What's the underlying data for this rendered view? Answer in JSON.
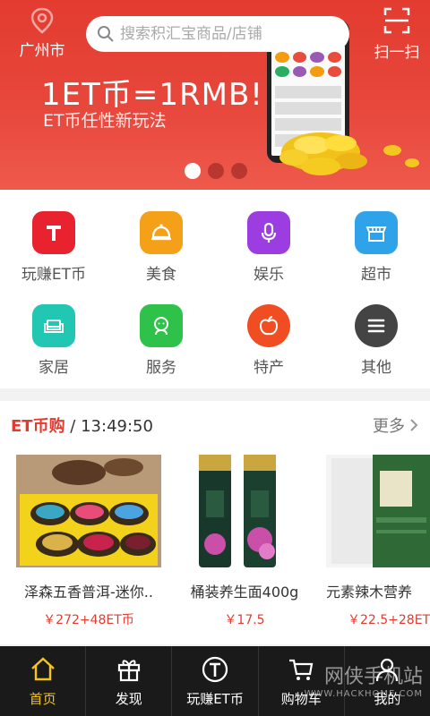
{
  "header": {
    "city": "广州市",
    "search_placeholder": "搜索积汇宝商品/店铺",
    "scan_label": "扫一扫"
  },
  "banner": {
    "headline": "1ET币=1RMB!",
    "subline": "ET币任性新玩法",
    "slide_count": 3,
    "active_slide": 1
  },
  "categories": [
    {
      "label": "玩赚ET币",
      "icon": "t-letter-icon",
      "color": "#e8232f"
    },
    {
      "label": "美食",
      "icon": "food-cloche-icon",
      "color": "#f5a019"
    },
    {
      "label": "娱乐",
      "icon": "microphone-icon",
      "color": "#9b3de0"
    },
    {
      "label": "超市",
      "icon": "store-icon",
      "color": "#2fa3ea"
    },
    {
      "label": "家居",
      "icon": "sofa-icon",
      "color": "#22c7b4"
    },
    {
      "label": "服务",
      "icon": "person-icon",
      "color": "#2ec24a"
    },
    {
      "label": "特产",
      "icon": "apple-icon",
      "color": "#f04e22"
    },
    {
      "label": "其他",
      "icon": "menu-icon",
      "color": "#444444"
    }
  ],
  "et_section": {
    "title": "ET币购",
    "separator": " / ",
    "time": "13:49:50",
    "more_label": "更多"
  },
  "products": [
    {
      "name": "泽森五香普洱-迷你..",
      "price": "￥272+48ET币"
    },
    {
      "name": "桶装养生面400g",
      "price": "￥17.5"
    },
    {
      "name": "元素辣木营养",
      "price": "￥22.5+28ET"
    }
  ],
  "tabs": [
    {
      "label": "首页",
      "icon": "home-icon",
      "active": true
    },
    {
      "label": "发现",
      "icon": "gift-icon",
      "active": false
    },
    {
      "label": "玩赚ET币",
      "icon": "t-coin-icon",
      "active": false
    },
    {
      "label": "购物车",
      "icon": "cart-icon",
      "active": false
    },
    {
      "label": "我的",
      "icon": "user-icon",
      "active": false
    }
  ],
  "watermark": {
    "text": "网侠手机站",
    "sub": "WWW.HACKHOME.COM"
  }
}
